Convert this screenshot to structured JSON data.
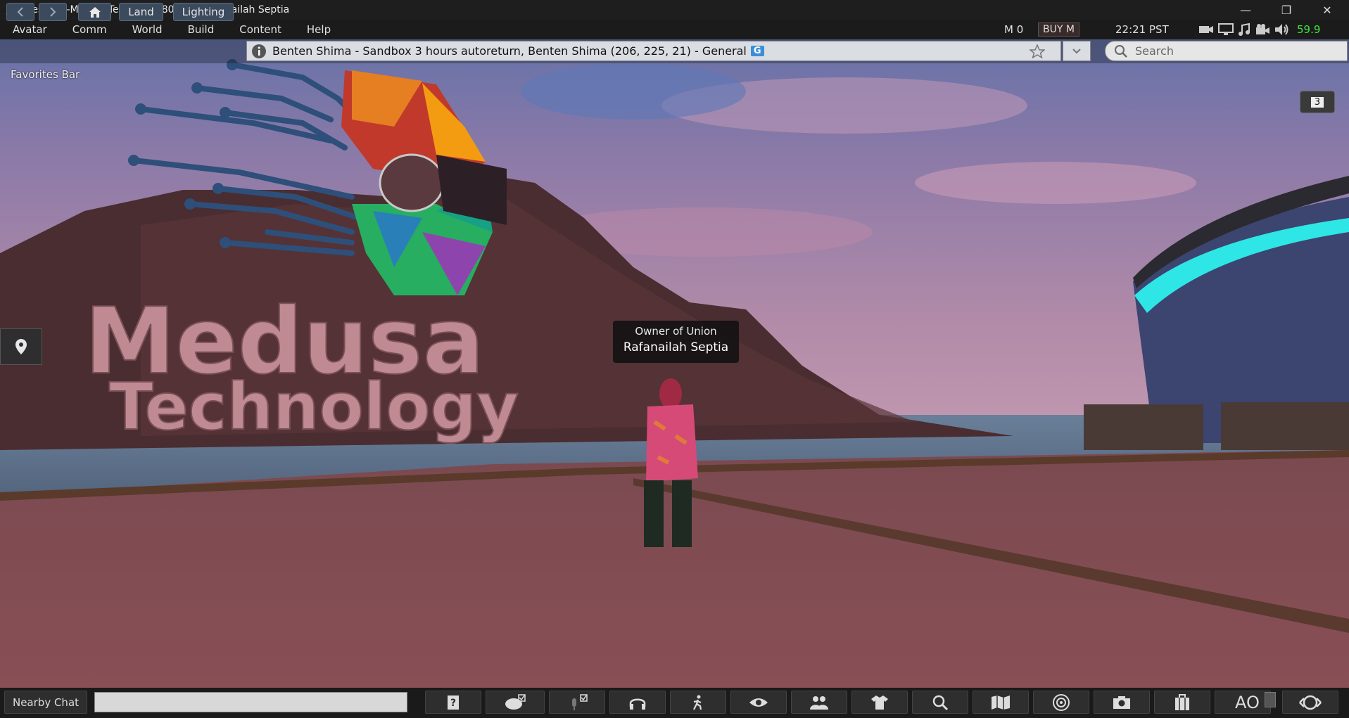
{
  "window": {
    "title": "Firestorm-MedusaTech 7.2.5.80778 - Rafanailah Septia",
    "controls": [
      "minimize-icon",
      "restore-icon",
      "close-icon"
    ]
  },
  "menubar": {
    "items": [
      "Avatar",
      "Comm",
      "World",
      "Build",
      "Content",
      "Help"
    ],
    "balance": "M 0",
    "buy_label": "BUY M",
    "time": "22:21 PST",
    "fps": "59.9"
  },
  "navbar": {
    "land_label": "Land",
    "lighting_label": "Lighting",
    "location": "Benten Shima - Sandbox 3 hours autoreturn, Benten Shima (206, 225, 21) - General",
    "maturity_badge": "G",
    "search_placeholder": "Search"
  },
  "favorites_bar": "Favorites Bar",
  "notification_count": "3",
  "scene": {
    "sign_line1": "Medusa",
    "sign_line2": "Technology"
  },
  "avatar_tag": {
    "group_title": "Owner of Union",
    "name": "Rafanailah Septia"
  },
  "bottombar": {
    "nearby_chat_label": "Nearby Chat",
    "ao_label": "AO",
    "buttons": [
      "help-icon",
      "chat-icon",
      "voice-icon",
      "headphones-icon",
      "move-icon",
      "view-icon",
      "people-icon",
      "appearance-icon",
      "search-icon",
      "map-icon",
      "radar-icon",
      "snapshot-icon",
      "inventory-icon",
      "ao-button",
      "quickprefs-icon"
    ]
  },
  "colors": {
    "accent_fps": "#3ee63e",
    "maturity_badge": "#3a8fd8",
    "button_bg": "#3b4a5c"
  }
}
